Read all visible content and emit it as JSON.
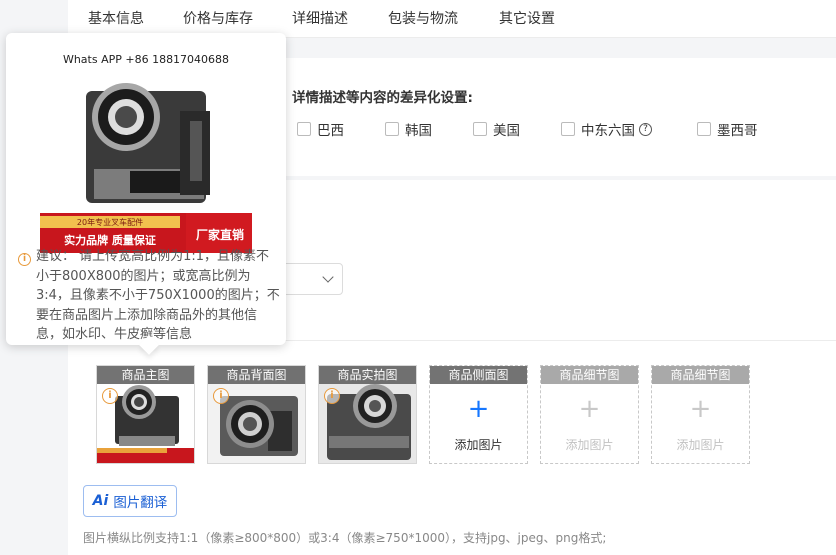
{
  "tabs": [
    "基本信息",
    "价格与库存",
    "详细描述",
    "包装与物流",
    "其它设置"
  ],
  "diff_section": {
    "title": "详情描述等内容的差异化设置:",
    "countries": [
      "巴西",
      "韩国",
      "美国",
      "中东六国",
      "墨西哥"
    ]
  },
  "image_slots": [
    {
      "label": "商品主图",
      "add_text": ""
    },
    {
      "label": "商品背面图",
      "add_text": ""
    },
    {
      "label": "商品实拍图",
      "add_text": ""
    },
    {
      "label": "商品侧面图",
      "add_text": "添加图片"
    },
    {
      "label": "商品细节图",
      "add_text": "添加图片"
    },
    {
      "label": "商品细节图",
      "add_text": "添加图片"
    }
  ],
  "plus_glyph": "+",
  "translate_button": {
    "ai": "Ai",
    "label": "图片翻译"
  },
  "hint_text": "图片横纵比例支持1:1（像素≥800*800）或3:4（像素≥750*1000），支持jpg、jpeg、png格式;",
  "popover": {
    "whatsapp": "Whats APP +86 18817040688",
    "banner_top": "20年专业叉车配件",
    "banner_mid": "实力品牌  质量保证",
    "banner_side": "厂家直销",
    "tip": "建议：  请上传宽高比例为1:1，且像素不小于800X800的图片；或宽高比例为3:4，且像素不小于750X1000的图片；不要在商品图片上添加除商品外的其他信息，如水印、牛皮癣等信息"
  },
  "colors": {
    "accent": "#1677ff",
    "warning": "#e89a3c",
    "banner_red": "#c8161d"
  }
}
